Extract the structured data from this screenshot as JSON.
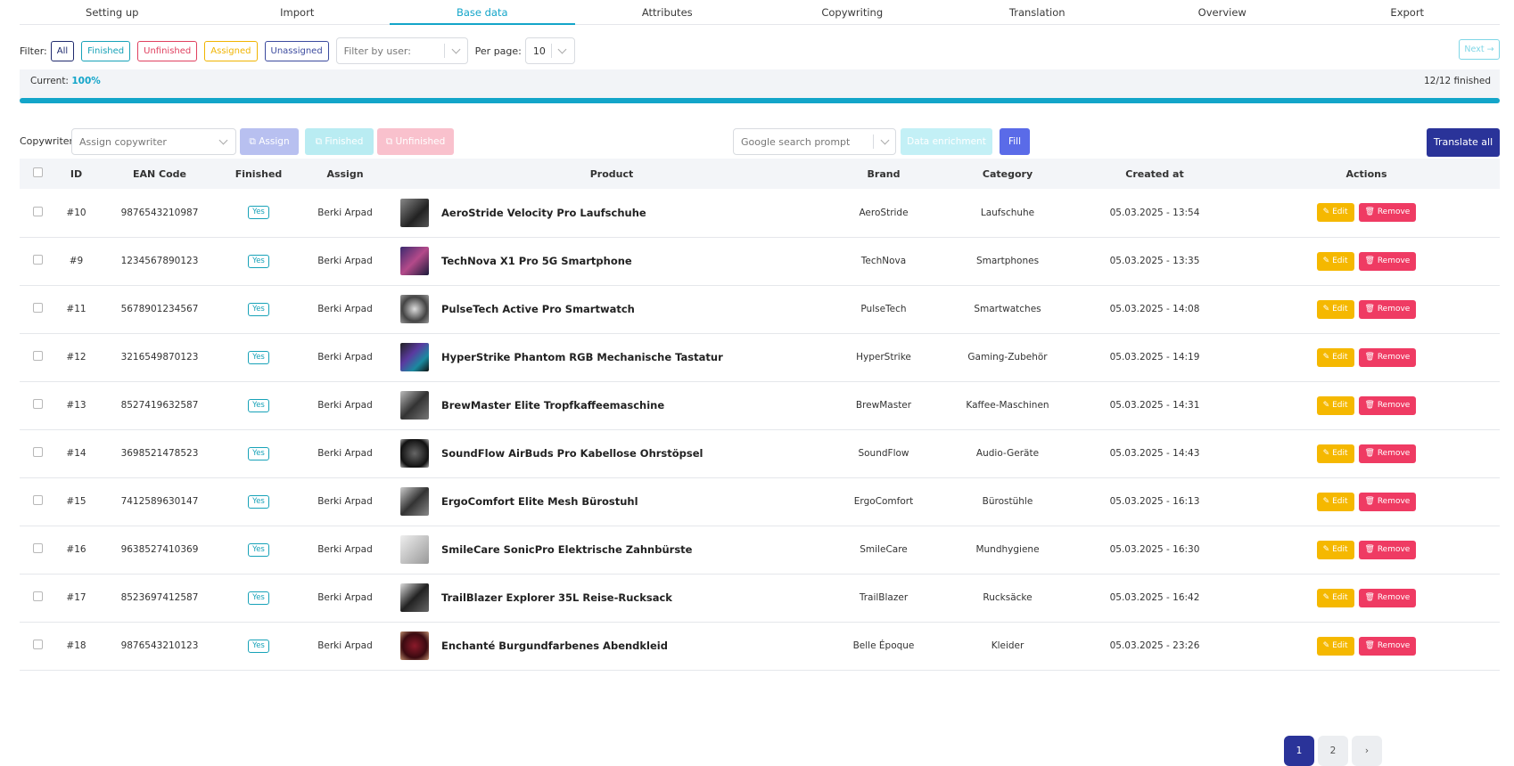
{
  "tabs": [
    "Setting up",
    "Import",
    "Base data",
    "Attributes",
    "Copywriting",
    "Translation",
    "Overview",
    "Export"
  ],
  "active_tab": "Base data",
  "filter": {
    "label": "Filter:",
    "chips": [
      "All",
      "Finished",
      "Unfinished",
      "Assigned",
      "Unassigned"
    ],
    "user_placeholder": "Filter by user:",
    "per_page_label": "Per page:",
    "per_page_value": "10",
    "next_label": "Next"
  },
  "progress": {
    "current_label": "Current:",
    "current_value": "100%",
    "finished_text": "12/12 finished",
    "fraction": 1.0
  },
  "toolbar": {
    "copywriter_label": "Copywriter:",
    "copywriter_placeholder": "Assign copywriter",
    "assign_label": "Assign",
    "finished_label": "Finished",
    "unfinished_label": "Unfinished",
    "prompt_placeholder": "Google search prompt",
    "enrichment_label": "Data enrichment",
    "fill_label": "Fill",
    "translate_label": "Translate all"
  },
  "table": {
    "headers": [
      "ID",
      "EAN Code",
      "Finished",
      "Assign",
      "Product",
      "Brand",
      "Category",
      "Created at",
      "Actions"
    ],
    "rows": [
      {
        "id": "#10",
        "ean": "9876543210987",
        "finished": "Yes",
        "assign": "Berki Arpad",
        "product": "AeroStride Velocity Pro Laufschuhe",
        "brand": "AeroStride",
        "category": "Laufschuhe",
        "created": "05.03.2025 - 13:54"
      },
      {
        "id": "#9",
        "ean": "1234567890123",
        "finished": "Yes",
        "assign": "Berki Arpad",
        "product": "TechNova X1 Pro 5G Smartphone",
        "brand": "TechNova",
        "category": "Smartphones",
        "created": "05.03.2025 - 13:35"
      },
      {
        "id": "#11",
        "ean": "5678901234567",
        "finished": "Yes",
        "assign": "Berki Arpad",
        "product": "PulseTech Active Pro Smartwatch",
        "brand": "PulseTech",
        "category": "Smartwatches",
        "created": "05.03.2025 - 14:08"
      },
      {
        "id": "#12",
        "ean": "3216549870123",
        "finished": "Yes",
        "assign": "Berki Arpad",
        "product": "HyperStrike Phantom RGB Mechanische Tastatur",
        "brand": "HyperStrike",
        "category": "Gaming-Zubehör",
        "created": "05.03.2025 - 14:19"
      },
      {
        "id": "#13",
        "ean": "8527419632587",
        "finished": "Yes",
        "assign": "Berki Arpad",
        "product": "BrewMaster Elite Tropfkaffeemaschine",
        "brand": "BrewMaster",
        "category": "Kaffee-Maschinen",
        "created": "05.03.2025 - 14:31"
      },
      {
        "id": "#14",
        "ean": "3698521478523",
        "finished": "Yes",
        "assign": "Berki Arpad",
        "product": "SoundFlow AirBuds Pro Kabellose Ohrstöpsel",
        "brand": "SoundFlow",
        "category": "Audio-Geräte",
        "created": "05.03.2025 - 14:43"
      },
      {
        "id": "#15",
        "ean": "7412589630147",
        "finished": "Yes",
        "assign": "Berki Arpad",
        "product": "ErgoComfort Elite Mesh Bürostuhl",
        "brand": "ErgoComfort",
        "category": "Bürostühle",
        "created": "05.03.2025 - 16:13"
      },
      {
        "id": "#16",
        "ean": "9638527410369",
        "finished": "Yes",
        "assign": "Berki Arpad",
        "product": "SmileCare SonicPro Elektrische Zahnbürste",
        "brand": "SmileCare",
        "category": "Mundhygiene",
        "created": "05.03.2025 - 16:30"
      },
      {
        "id": "#17",
        "ean": "8523697412587",
        "finished": "Yes",
        "assign": "Berki Arpad",
        "product": "TrailBlazer Explorer 35L Reise-Rucksack",
        "brand": "TrailBlazer",
        "category": "Rucksäcke",
        "created": "05.03.2025 - 16:42"
      },
      {
        "id": "#18",
        "ean": "9876543210123",
        "finished": "Yes",
        "assign": "Berki Arpad",
        "product": "Enchanté Burgundfarbenes Abendkleid",
        "brand": "Belle Époque",
        "category": "Kleider",
        "created": "05.03.2025 - 23:26"
      }
    ],
    "edit_label": "Edit",
    "remove_label": "Remove"
  },
  "pagination": {
    "pages": [
      "1",
      "2"
    ],
    "current": "1",
    "next_symbol": "›"
  },
  "colors": {
    "accent": "#13a5c9",
    "navy": "#2a3399",
    "edit": "#f5b800",
    "remove": "#ef3b63"
  }
}
